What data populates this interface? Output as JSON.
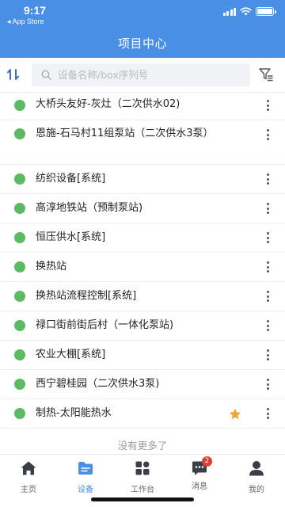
{
  "status_bar": {
    "time": "9:17",
    "back_app": "◂ App Store"
  },
  "header": {
    "title": "项目中心"
  },
  "search": {
    "placeholder": "设备名称/box序列号",
    "value": ""
  },
  "colors": {
    "header_bg": "#4a8fe6",
    "online_dot": "#5cba62",
    "favorite_star": "#f0a53a",
    "active_tab": "#4a8fe6"
  },
  "items": [
    {
      "label": "大桥头友好-灰灶（二次供水02)",
      "status": "online",
      "favorite": false
    },
    {
      "label": "恩施-石马村11组泵站（二次供水3泵）",
      "status": "online",
      "favorite": false
    },
    {
      "label": "纺织设备[系统]",
      "status": "online",
      "favorite": false
    },
    {
      "label": "高淳地铁站（预制泵站)",
      "status": "online",
      "favorite": false
    },
    {
      "label": "恒压供水[系统]",
      "status": "online",
      "favorite": false
    },
    {
      "label": "换热站",
      "status": "online",
      "favorite": false
    },
    {
      "label": "换热站流程控制[系统]",
      "status": "online",
      "favorite": false
    },
    {
      "label": "禄口街前街后村（一体化泵站)",
      "status": "online",
      "favorite": false
    },
    {
      "label": "农业大棚[系统]",
      "status": "online",
      "favorite": false
    },
    {
      "label": "西宁碧桂园（二次供水3泵)",
      "status": "online",
      "favorite": false
    },
    {
      "label": "制热-太阳能热水",
      "status": "online",
      "favorite": true
    }
  ],
  "no_more_text": "没有更多了",
  "tabbar": {
    "tabs": [
      {
        "label": "主页",
        "icon": "home-icon",
        "active": false
      },
      {
        "label": "设备",
        "icon": "device-folder-icon",
        "active": true
      },
      {
        "label": "工作台",
        "icon": "workbench-grid-icon",
        "active": false
      },
      {
        "label": "消息",
        "icon": "message-icon",
        "active": false,
        "badge": "2"
      },
      {
        "label": "我的",
        "icon": "user-icon",
        "active": false
      }
    ]
  }
}
